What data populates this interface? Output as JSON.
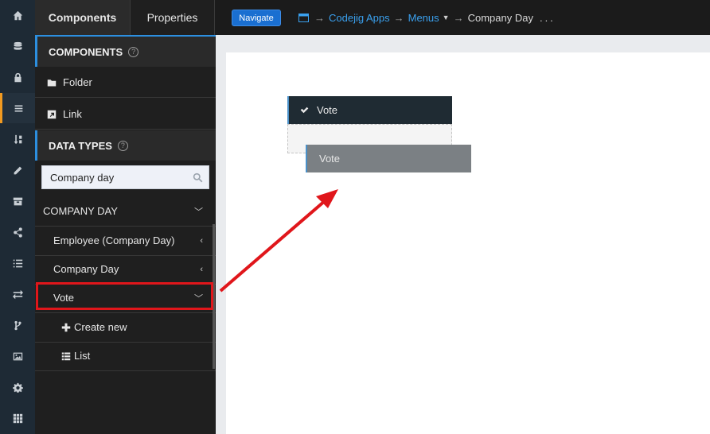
{
  "rail": {
    "icons": [
      "home-icon",
      "database-icon",
      "lock-icon",
      "menu-icon",
      "sort-icon",
      "pencil-icon",
      "archive-icon",
      "share-icon",
      "list-icon",
      "transfer-icon",
      "branch-icon",
      "image-icon",
      "gear-icon",
      "apps-icon"
    ],
    "active": "menu-icon"
  },
  "tabs": {
    "components": "Components",
    "properties": "Properties"
  },
  "navigate_button": "Navigate",
  "breadcrumb": {
    "app": "Codejig Apps",
    "section": "Menus",
    "current": "Company Day",
    "more": "..."
  },
  "panel": {
    "components_title": "COMPONENTS",
    "folder": "Folder",
    "link": "Link",
    "data_types_title": "DATA TYPES",
    "search": {
      "value": "Company day",
      "placeholder": ""
    },
    "group_title": "COMPANY DAY",
    "items": [
      {
        "label": "Employee (Company Day)"
      },
      {
        "label": "Company Day"
      },
      {
        "label": "Vote"
      }
    ],
    "sub_items": [
      {
        "label": "Create new"
      },
      {
        "label": "List"
      }
    ]
  },
  "canvas": {
    "menu_item": "Vote",
    "dragging_item": "Vote"
  },
  "colors": {
    "accent": "#2c8fe0",
    "active_rail": "#f29a20",
    "highlight": "#e0161b",
    "navigate": "#1a6fd1"
  }
}
